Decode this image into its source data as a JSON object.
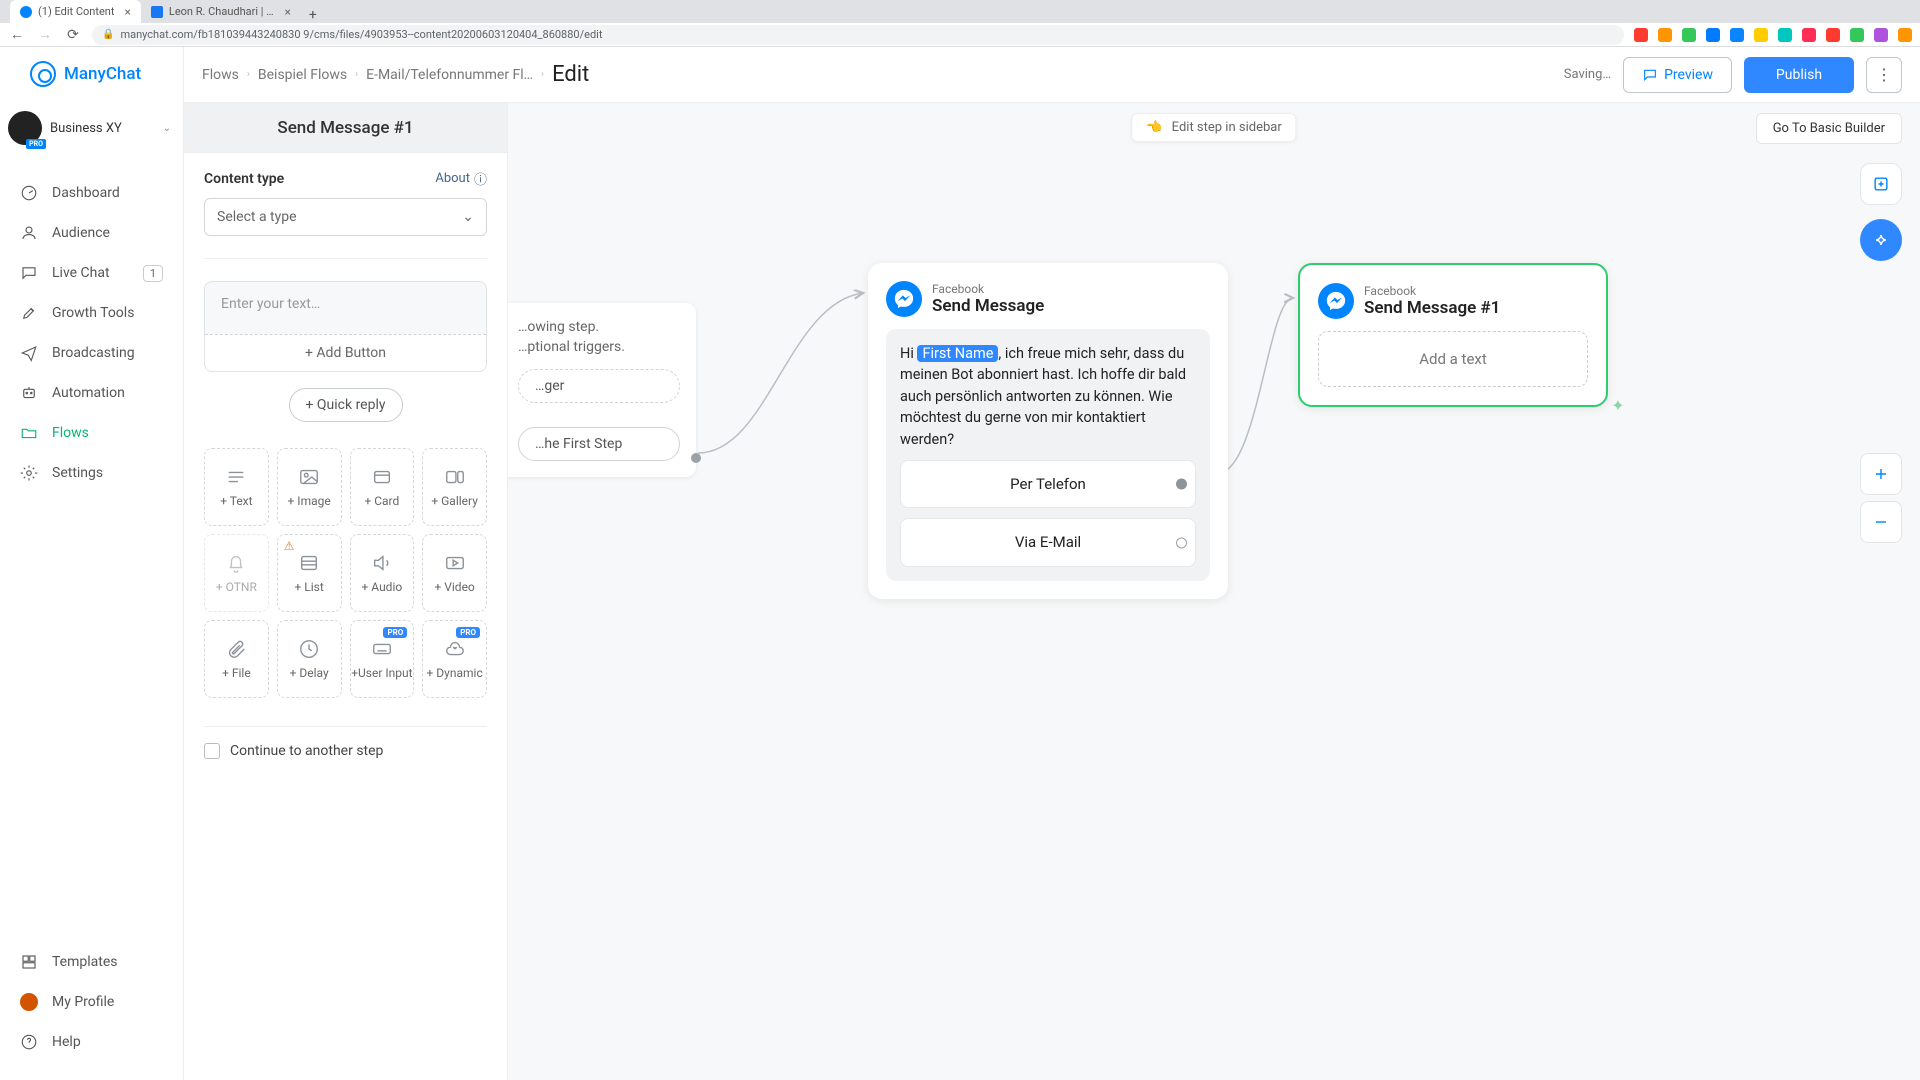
{
  "browser": {
    "tabs": [
      {
        "title": "(1) Edit Content",
        "active": true
      },
      {
        "title": "Leon R. Chaudhari | Facebook",
        "active": false
      }
    ],
    "url": "manychat.com/fb181039443240830 9/cms/files/4903953--content20200603120404_860880/edit"
  },
  "brand_name": "ManyChat",
  "workspace_name": "Business XY",
  "pro_label": "PRO",
  "nav": {
    "dashboard": "Dashboard",
    "audience": "Audience",
    "livechat": "Live Chat",
    "livechat_count": "1",
    "growthtools": "Growth Tools",
    "broadcasting": "Broadcasting",
    "automation": "Automation",
    "flows": "Flows",
    "settings": "Settings",
    "templates": "Templates",
    "myprofile": "My Profile",
    "help": "Help"
  },
  "crumbs": {
    "c1": "Flows",
    "c2": "Beispiel Flows",
    "c3": "E-Mail/Telefonnummer Fl…",
    "current": "Edit"
  },
  "appbar": {
    "saving": "Saving…",
    "preview": "Preview",
    "publish": "Publish"
  },
  "panel": {
    "step_title": "Send Message #1",
    "content_type_label": "Content type",
    "about_label": "About",
    "select_placeholder": "Select a type",
    "text_placeholder": "Enter your text…",
    "add_button": "+ Add Button",
    "quick_reply": "+ Quick reply",
    "continue": "Continue to another step",
    "items": {
      "text": "+ Text",
      "image": "+ Image",
      "card": "+ Card",
      "gallery": "+ Gallery",
      "otnr": "+ OTNR",
      "list": "+ List",
      "audio": "+ Audio",
      "video": "+ Video",
      "file": "+ File",
      "delay": "+ Delay",
      "userinput": "+User Input",
      "dynamic": "+ Dynamic"
    }
  },
  "canvas": {
    "edit_toast": "Edit step in sidebar",
    "basic_link": "Go To Basic Builder",
    "node_a": {
      "line1": "…owing step.",
      "line2": "…ptional triggers.",
      "trigger": "…ger",
      "first_step": "…he First Step"
    },
    "node_b": {
      "channel": "Facebook",
      "title": "Send Message",
      "msg_prefix": "Hi ",
      "msg_var": "First Name",
      "msg_rest": ", ich freue mich sehr, dass du meinen Bot abonniert hast. Ich hoffe dir bald auch persönlich antworten zu können. Wie möchtest du gerne von mir kontaktiert werden?",
      "btn1": "Per Telefon",
      "btn2": "Via E-Mail"
    },
    "node_c": {
      "channel": "Facebook",
      "title": "Send Message #1",
      "add_text": "Add a text"
    }
  },
  "ext_colors": [
    "#ff3b30",
    "#ff9500",
    "#34c759",
    "#007aff",
    "#0a84ff",
    "#ffcc00",
    "#00c7be",
    "#ff2d55",
    "#ff3b30",
    "#34c759",
    "#af52de",
    "#ff9500"
  ]
}
